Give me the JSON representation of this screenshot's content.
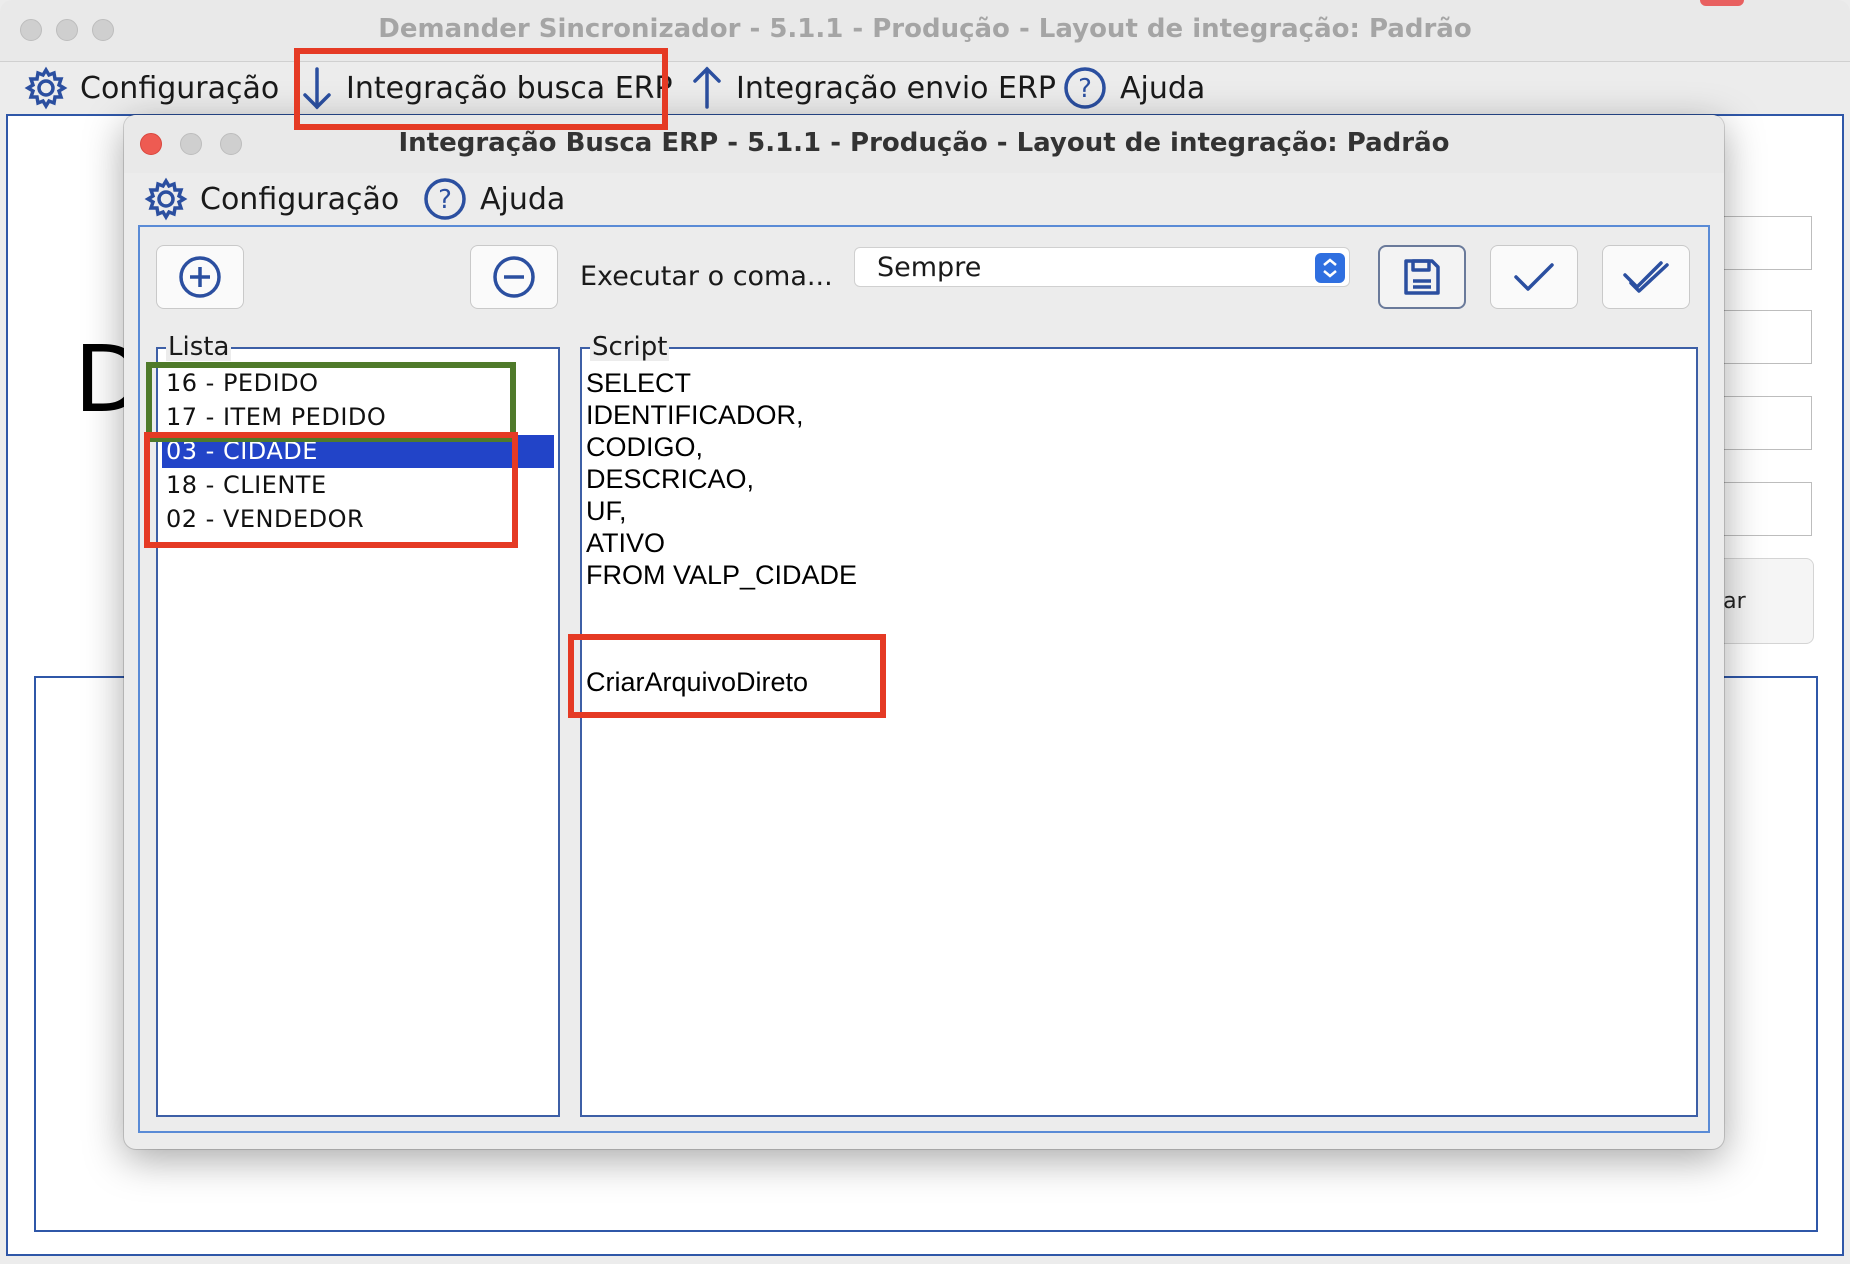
{
  "main_window": {
    "title": "Demander Sincronizador - 5.1.1 - Produção - Layout de integração: Padrão",
    "menu": [
      {
        "label": "Configuração",
        "icon": "gear-icon"
      },
      {
        "label": "Integração busca ERP",
        "icon": "arrow-down-icon"
      },
      {
        "label": "Integração envio ERP",
        "icon": "arrow-up-icon"
      },
      {
        "label": "Ajuda",
        "icon": "help-icon"
      }
    ],
    "background": {
      "big_letter": "D",
      "button_fragment": "iar"
    }
  },
  "dialog": {
    "title": "Integração Busca ERP - 5.1.1 - Produção - Layout de integração: Padrão",
    "menu": [
      {
        "label": "Configuração",
        "icon": "gear-icon"
      },
      {
        "label": "Ajuda",
        "icon": "help-icon"
      }
    ],
    "toolbar": {
      "add_icon": "plus-circle-icon",
      "remove_icon": "minus-circle-icon",
      "exec_label": "Executar o coma...",
      "exec_value": "Sempre",
      "save_icon": "floppy-icon",
      "check_icon": "check-icon",
      "check_all_icon": "double-check-icon"
    },
    "lista": {
      "title": "Lista",
      "items": [
        "16 - PEDIDO",
        "17 - ITEM PEDIDO",
        "03 - CIDADE",
        "18 - CLIENTE",
        "02 - VENDEDOR"
      ],
      "selected_index": 2
    },
    "script": {
      "title": "Script",
      "text": "SELECT\nIDENTIFICADOR,\nCODIGO,\nDESCRICAO,\nUF,\nATIVO\nFROM VALP_CIDADE",
      "extra": "CriarArquivoDireto"
    }
  },
  "colors": {
    "accent_blue": "#2244c8",
    "annotation_red": "#e53a24",
    "annotation_green": "#4f7a2a"
  }
}
